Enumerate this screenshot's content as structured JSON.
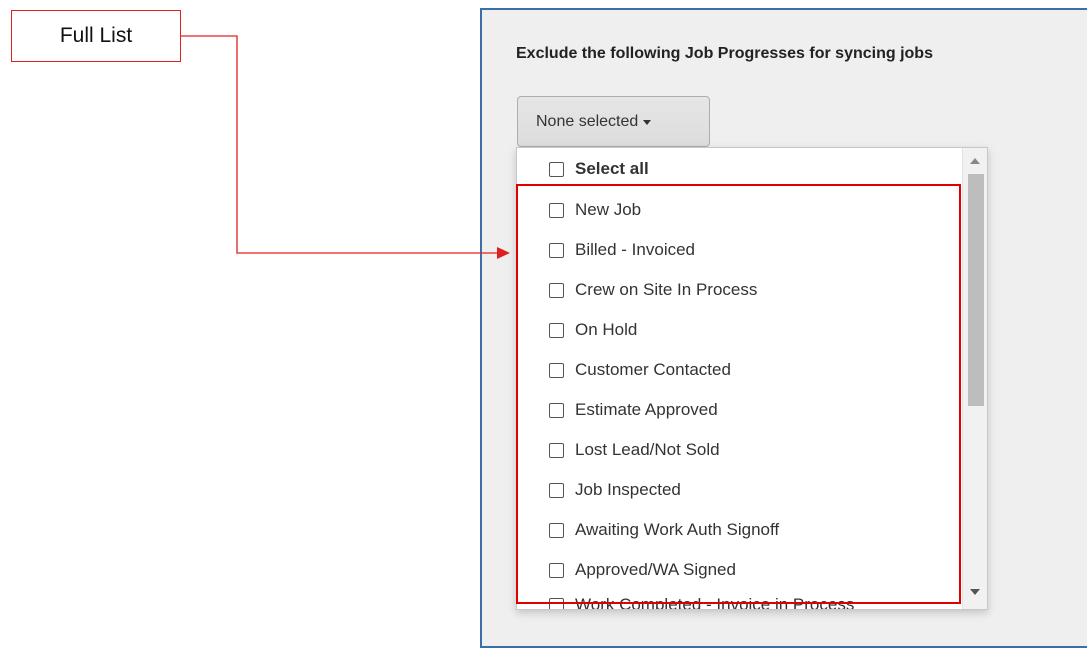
{
  "annotation": {
    "label": "Full List",
    "color": "#e02020"
  },
  "panel": {
    "heading": "Exclude the following Job Progresses for syncing jobs",
    "dropdown_label": "None selected"
  },
  "menu": {
    "select_all_label": "Select all",
    "items": [
      "New Job",
      "Billed - Invoiced",
      "Crew on Site In Process",
      "On Hold",
      "Customer Contacted",
      "Estimate Approved",
      "Lost Lead/Not Sold",
      "Job Inspected",
      "Awaiting Work Auth Signoff",
      "Approved/WA Signed",
      "Work Completed - Invoice in Process"
    ]
  },
  "icons": {
    "dropdown_caret": "caret-down-icon",
    "scroll_up": "scroll-up-arrow-icon",
    "scroll_down": "scroll-down-arrow-icon",
    "checkbox": "checkbox-icon"
  }
}
